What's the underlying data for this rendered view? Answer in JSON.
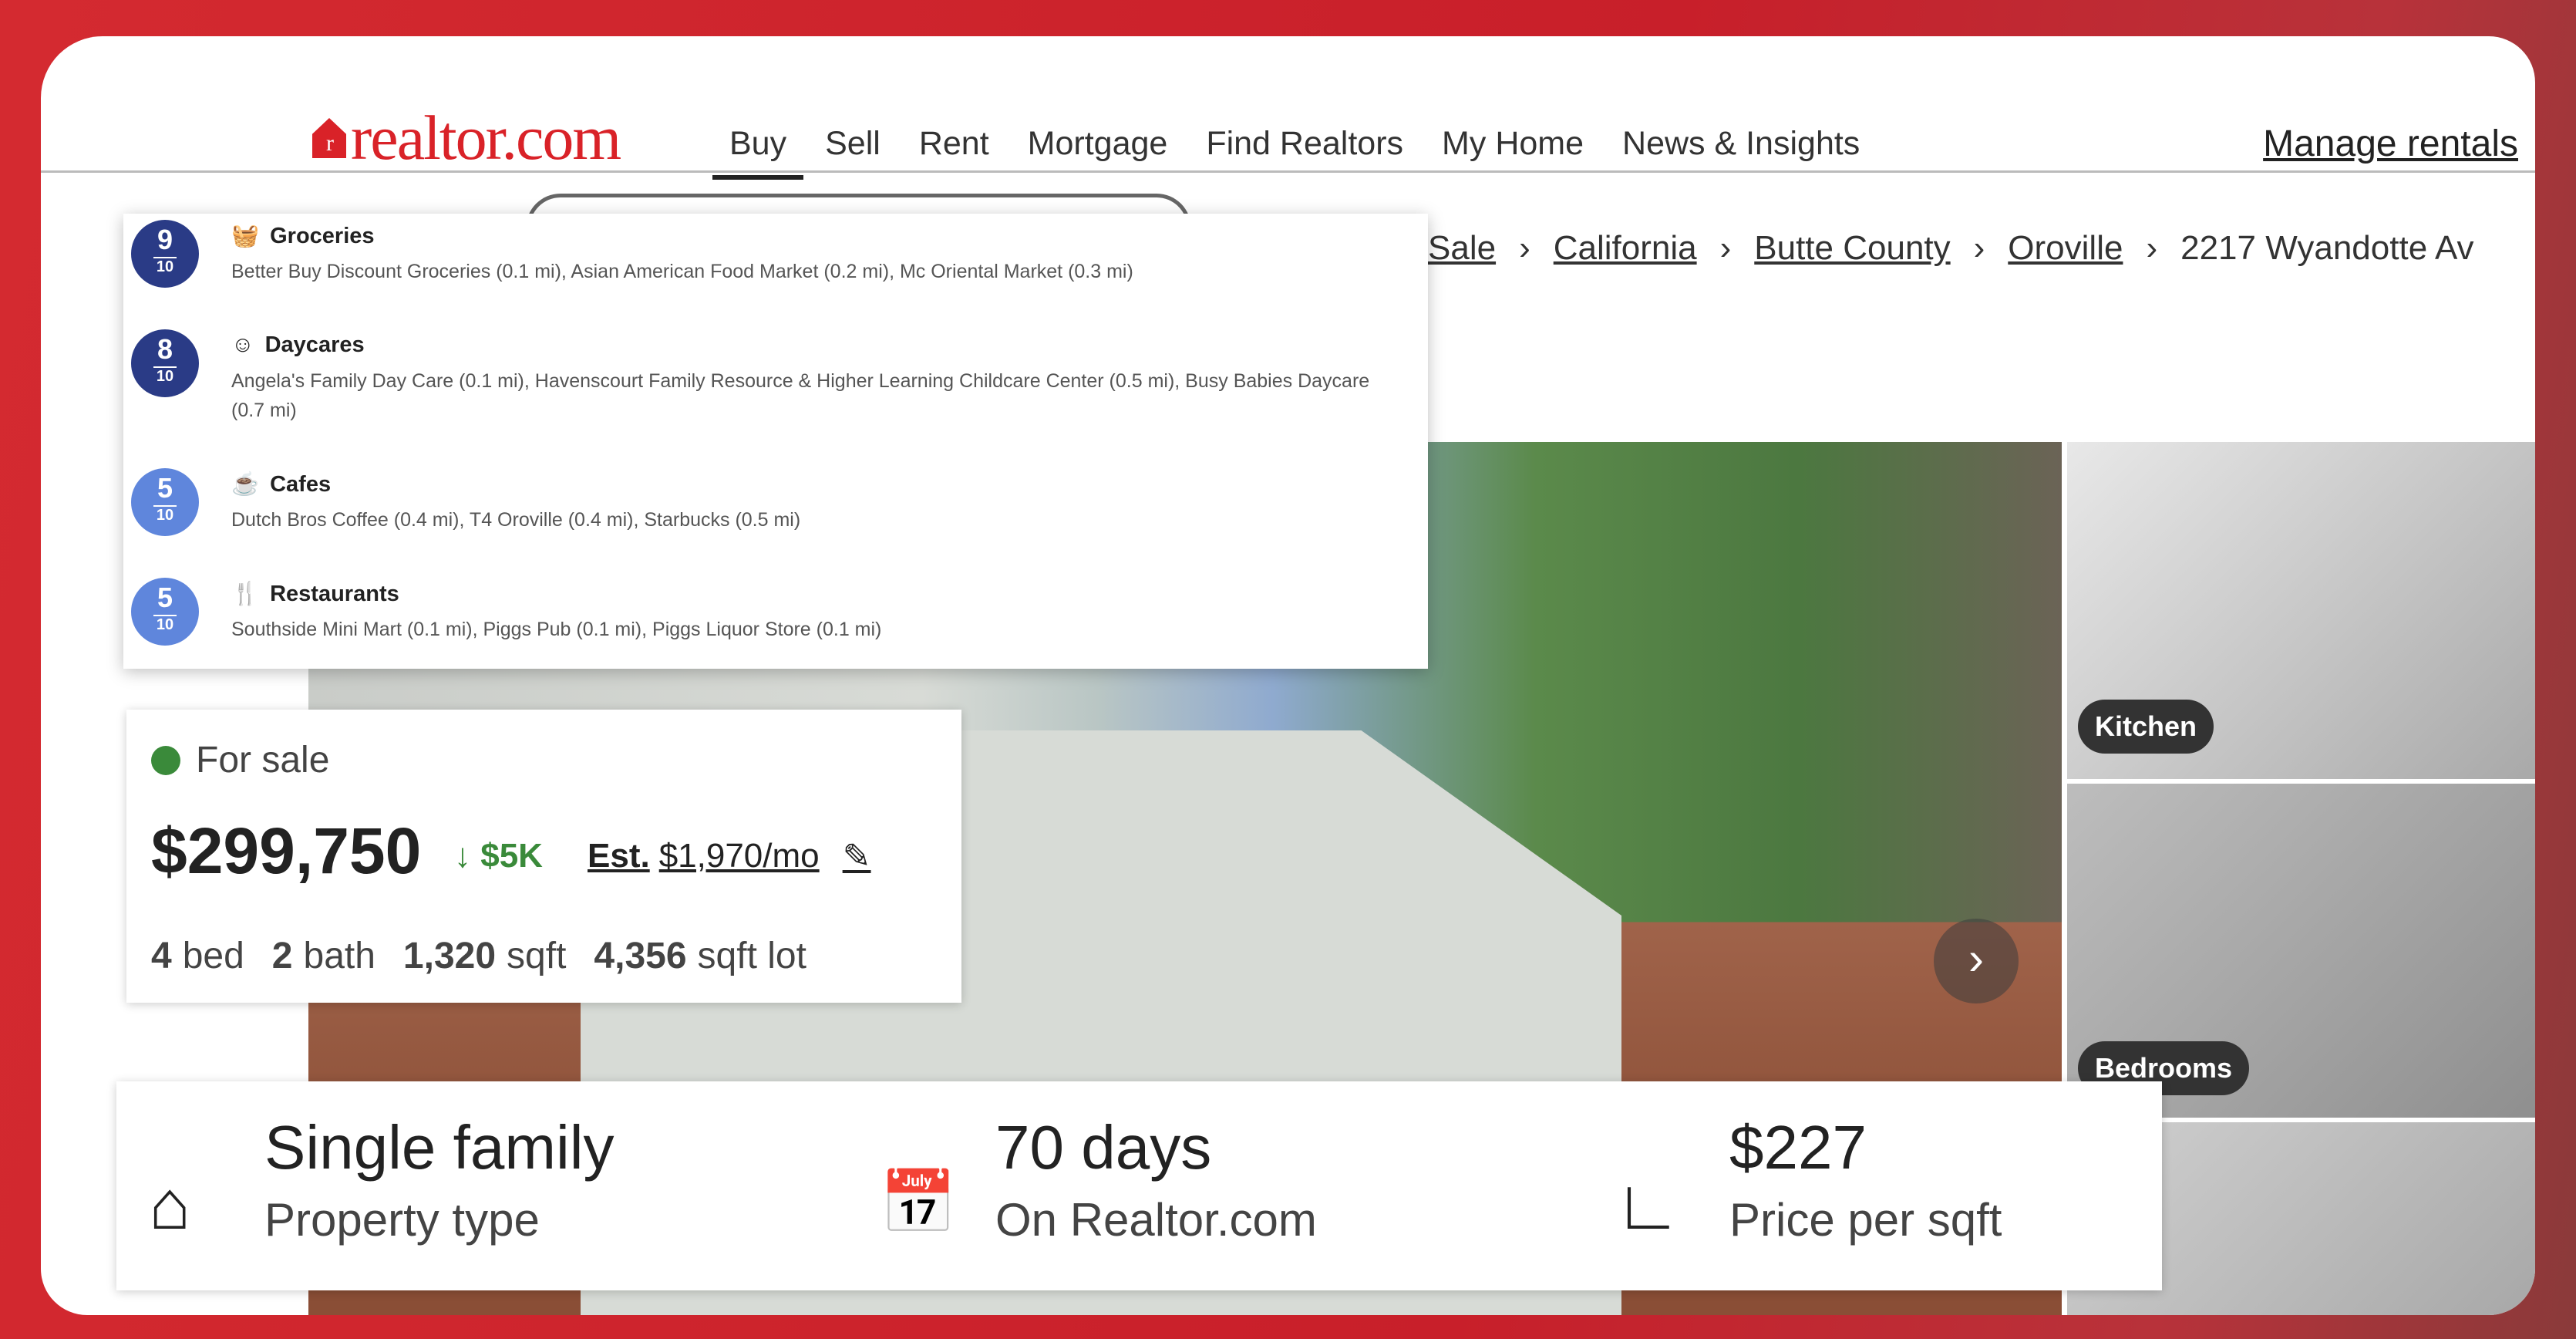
{
  "brand": {
    "logo": "realtor.com",
    "color": "#d92228"
  },
  "nav": {
    "items": [
      "Buy",
      "Sell",
      "Rent",
      "Mortgage",
      "Find Realtors",
      "My Home",
      "News & Insights"
    ],
    "active": "Buy",
    "manage": "Manage rentals"
  },
  "breadcrumb": [
    "Sale",
    "California",
    "Butte County",
    "Oroville",
    "2217 Wyandotte Av"
  ],
  "nearby": [
    {
      "score": "9",
      "of": "10",
      "title": "Groceries",
      "icon": "grocery-basket-icon",
      "color": "#2a3b86",
      "desc": "Better Buy Discount Groceries (0.1 mi), Asian American Food Market (0.2 mi), Mc Oriental Market (0.3 mi)"
    },
    {
      "score": "8",
      "of": "10",
      "title": "Daycares",
      "icon": "baby-face-icon",
      "color": "#2a3b86",
      "desc": "Angela's Family Day Care (0.1 mi), Havenscourt Family Resource & Higher Learning Childcare Center (0.5 mi), Busy Babies Daycare (0.7 mi)"
    },
    {
      "score": "5",
      "of": "10",
      "title": "Cafes",
      "icon": "coffee-cup-icon",
      "color": "#5f86dc",
      "desc": "Dutch Bros Coffee (0.4 mi), T4 Oroville (0.4 mi), Starbucks (0.5 mi)"
    },
    {
      "score": "5",
      "of": "10",
      "title": "Restaurants",
      "icon": "fork-knife-icon",
      "color": "#5f86dc",
      "desc": "Southside Mini Mart (0.1 mi), Piggs Pub (0.1 mi), Piggs Liquor Store (0.1 mi)"
    }
  ],
  "listing": {
    "status": "For sale",
    "status_color": "#3a8a3a",
    "price": "$299,750",
    "drop": "↓ $5K",
    "est_label": "Est.",
    "est_value": "$1,970/mo",
    "beds": "4",
    "beds_l": "bed",
    "baths": "2",
    "baths_l": "bath",
    "sqft": "1,320",
    "sqft_l": "sqft",
    "lot": "4,356",
    "lot_l": "sqft lot"
  },
  "photos": {
    "thumbs": [
      "Kitchen",
      "Bedrooms"
    ]
  },
  "facts": [
    {
      "value": "Single family",
      "label": "Property type",
      "icon": "house-icon"
    },
    {
      "value": "70 days",
      "label": "On Realtor.com",
      "icon": "calendar-icon"
    },
    {
      "value": "$227",
      "label": "Price per sqft",
      "icon": "ruler-icon"
    }
  ]
}
